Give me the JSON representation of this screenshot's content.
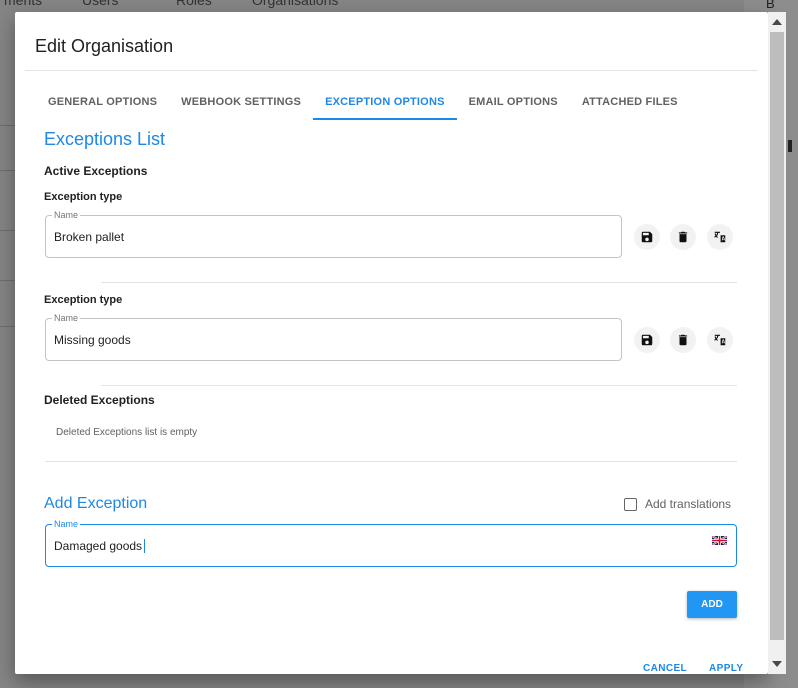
{
  "background": {
    "nav_items": [
      "ments",
      "Users",
      "Roles",
      "Organisations"
    ],
    "right_letter": "B"
  },
  "dialog": {
    "title": "Edit Organisation",
    "tabs": [
      {
        "label": "GENERAL OPTIONS",
        "active": false
      },
      {
        "label": "WEBHOOK SETTINGS",
        "active": false
      },
      {
        "label": "EXCEPTION OPTIONS",
        "active": true
      },
      {
        "label": "EMAIL OPTIONS",
        "active": false
      },
      {
        "label": "ATTACHED FILES",
        "active": false
      }
    ],
    "exceptions_list_heading": "Exceptions List",
    "active_heading": "Active Exceptions",
    "active_exceptions": [
      {
        "type_label": "Exception type",
        "name_label": "Name",
        "value": "Broken pallet"
      },
      {
        "type_label": "Exception type",
        "name_label": "Name",
        "value": "Missing goods"
      }
    ],
    "deleted_heading": "Deleted Exceptions",
    "deleted_empty": "Deleted Exceptions list is empty",
    "add_heading": "Add Exception",
    "add_translations_label": "Add translations",
    "add_translations_checked": false,
    "add_field": {
      "label": "Name",
      "value": "Damaged goods"
    },
    "add_button": "ADD",
    "cancel_button": "CANCEL",
    "apply_button": "APPLY"
  },
  "colors": {
    "accent": "#1e88e5",
    "button": "#2196f3"
  }
}
